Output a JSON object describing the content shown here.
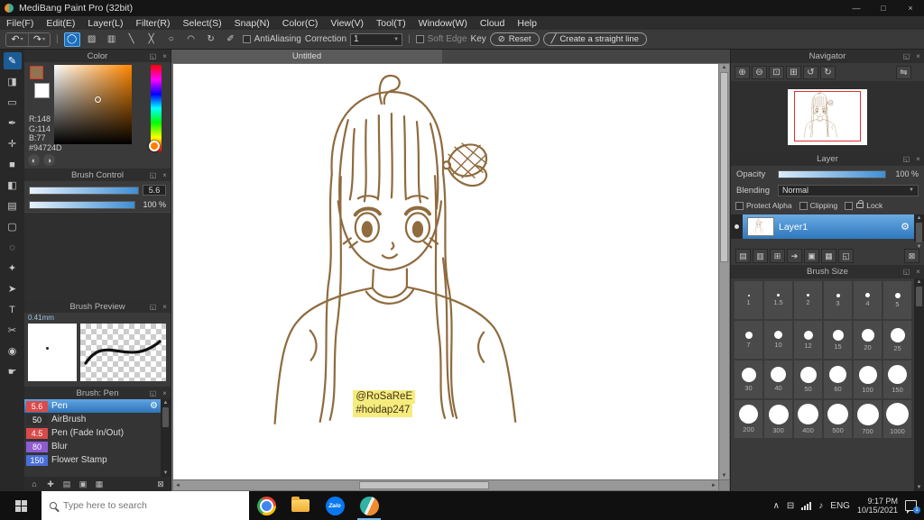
{
  "window": {
    "title": "MediBang Paint Pro (32bit)"
  },
  "menu": {
    "items": [
      "File(F)",
      "Edit(E)",
      "Layer(L)",
      "Filter(R)",
      "Select(S)",
      "Snap(N)",
      "Color(C)",
      "View(V)",
      "Tool(T)",
      "Window(W)",
      "Cloud",
      "Help"
    ]
  },
  "toolbar": {
    "antialiasing_label": "AntiAliasing",
    "correction_label": "Correction",
    "correction_value": "1",
    "soft_edge_label": "Soft Edge",
    "key_label": "Key",
    "reset_label": "Reset",
    "straight_line_label": "Create a straight line"
  },
  "tools": [
    {
      "name": "brush",
      "glyph": "✎"
    },
    {
      "name": "eraser",
      "glyph": "◨"
    },
    {
      "name": "select-rect",
      "glyph": "▭"
    },
    {
      "name": "pen",
      "glyph": "✒"
    },
    {
      "name": "move",
      "glyph": "✛"
    },
    {
      "name": "shape",
      "glyph": "■"
    },
    {
      "name": "bucket",
      "glyph": "◧"
    },
    {
      "name": "gradient",
      "glyph": "▤"
    },
    {
      "name": "marquee",
      "glyph": "▢"
    },
    {
      "name": "lasso",
      "glyph": "◌"
    },
    {
      "name": "magic-wand",
      "glyph": "✦"
    },
    {
      "name": "operation",
      "glyph": "➤"
    },
    {
      "name": "text",
      "glyph": "T"
    },
    {
      "name": "divide",
      "glyph": "✂"
    },
    {
      "name": "eyedropper",
      "glyph": "◉"
    },
    {
      "name": "hand",
      "glyph": "☛"
    }
  ],
  "color_panel": {
    "title": "Color",
    "r": "R:148",
    "g": "G:114",
    "b": "B:77",
    "hex": "#94724D",
    "current": "#94724D"
  },
  "brush_control": {
    "title": "Brush Control",
    "size_value": "5.6",
    "opacity_value": "100 %"
  },
  "brush_preview": {
    "title": "Brush Preview",
    "size_label": "0.41mm"
  },
  "brushes": {
    "title": "Brush: Pen",
    "items": [
      {
        "size": "5.6",
        "name": "Pen",
        "chip": "#d94a4a"
      },
      {
        "size": "50",
        "name": "AirBrush",
        "chip": "#303030"
      },
      {
        "size": "4.5",
        "name": "Pen (Fade In/Out)",
        "chip": "#d94a4a"
      },
      {
        "size": "80",
        "name": "Blur",
        "chip": "#8e5bd0"
      },
      {
        "size": "150",
        "name": "Flower Stamp",
        "chip": "#4a6fd8"
      }
    ]
  },
  "canvas": {
    "tab": "Untitled",
    "signature_line1": "@RoSaReE",
    "signature_line2": "#hoidap247",
    "highlight": "#f6ec7e"
  },
  "navigator": {
    "title": "Navigator"
  },
  "layer_panel": {
    "title": "Layer",
    "opacity_label": "Opacity",
    "opacity_value": "100 %",
    "blending_label": "Blending",
    "blending_value": "Normal",
    "protect_alpha_label": "Protect Alpha",
    "clipping_label": "Clipping",
    "lock_label": "Lock",
    "layer_name": "Layer1"
  },
  "brush_size": {
    "title": "Brush Size",
    "sizes": [
      "1",
      "1.5",
      "2",
      "3",
      "4",
      "5",
      "7",
      "10",
      "12",
      "15",
      "20",
      "25",
      "30",
      "40",
      "50",
      "60",
      "100",
      "150",
      "200",
      "300",
      "400",
      "500",
      "700",
      "1000"
    ]
  },
  "taskbar": {
    "search_placeholder": "Type here to search",
    "zalo_label": "Zalo",
    "language": "ENG",
    "time": "9:17 PM",
    "date": "10/15/2021",
    "notification_badge": "1"
  },
  "icons": {
    "minimize": "—",
    "maximize": "□",
    "close": "×",
    "undo": "↶",
    "redo": "↷",
    "caret": "▾",
    "mode1": "◯",
    "mode2": "▨",
    "mode3": "▥",
    "mode4": "╲",
    "mode5": "╳",
    "mode6": "○",
    "mode7": "◠",
    "mode8": "↻",
    "mode9": "✐",
    "reset_glyph": "⊘",
    "line_glyph": "╱",
    "popout": "◱",
    "panel_close": "×",
    "up": "▲",
    "down": "▼",
    "left": "◄",
    "right": "►",
    "pal1": "◐",
    "pal2": "◑",
    "gear": "⚙",
    "zoom_in": "⊕",
    "zoom_out": "⊖",
    "zoom_fit": "⊡",
    "zoom_actual": "⊞",
    "rot_ccw": "↺",
    "rot_cw": "↻",
    "flip": "⇋",
    "home": "⌂",
    "page": "▤",
    "page2": "▥",
    "folder": "▣",
    "folder2": "▦",
    "trash": "⊠",
    "add": "✚",
    "arrow": "➔",
    "grid": "⊞",
    "chevron_up": "∧",
    "display": "⊟",
    "note": "♪"
  }
}
